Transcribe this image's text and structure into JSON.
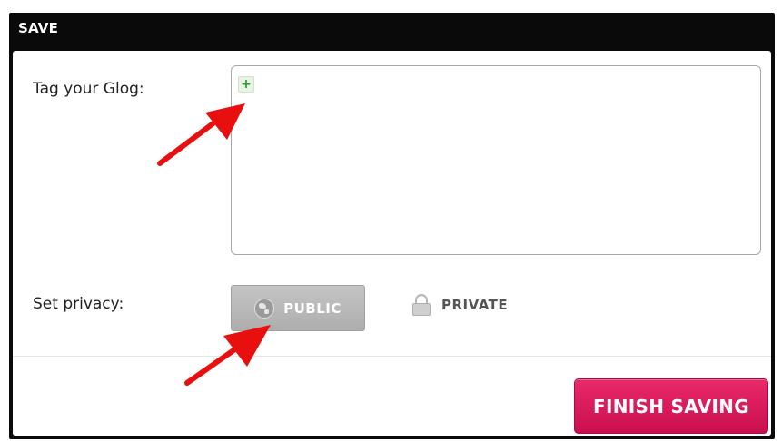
{
  "dialog": {
    "title": "SAVE"
  },
  "tags": {
    "label": "Tag your Glog:",
    "add_symbol": "+"
  },
  "privacy": {
    "label": "Set privacy:",
    "options": [
      {
        "label": "PUBLIC",
        "icon": "globe-icon",
        "selected": true
      },
      {
        "label": "PRIVATE",
        "icon": "lock-icon",
        "selected": false
      }
    ]
  },
  "footer": {
    "finish_label": "FINISH SAVING"
  },
  "colors": {
    "header_bg": "#0a0a0a",
    "finish_button": "#d9175a",
    "public_selected": "#b8b8b8",
    "add_tag_green": "#2a9a2a",
    "annotation_arrow": "#e8100f"
  }
}
